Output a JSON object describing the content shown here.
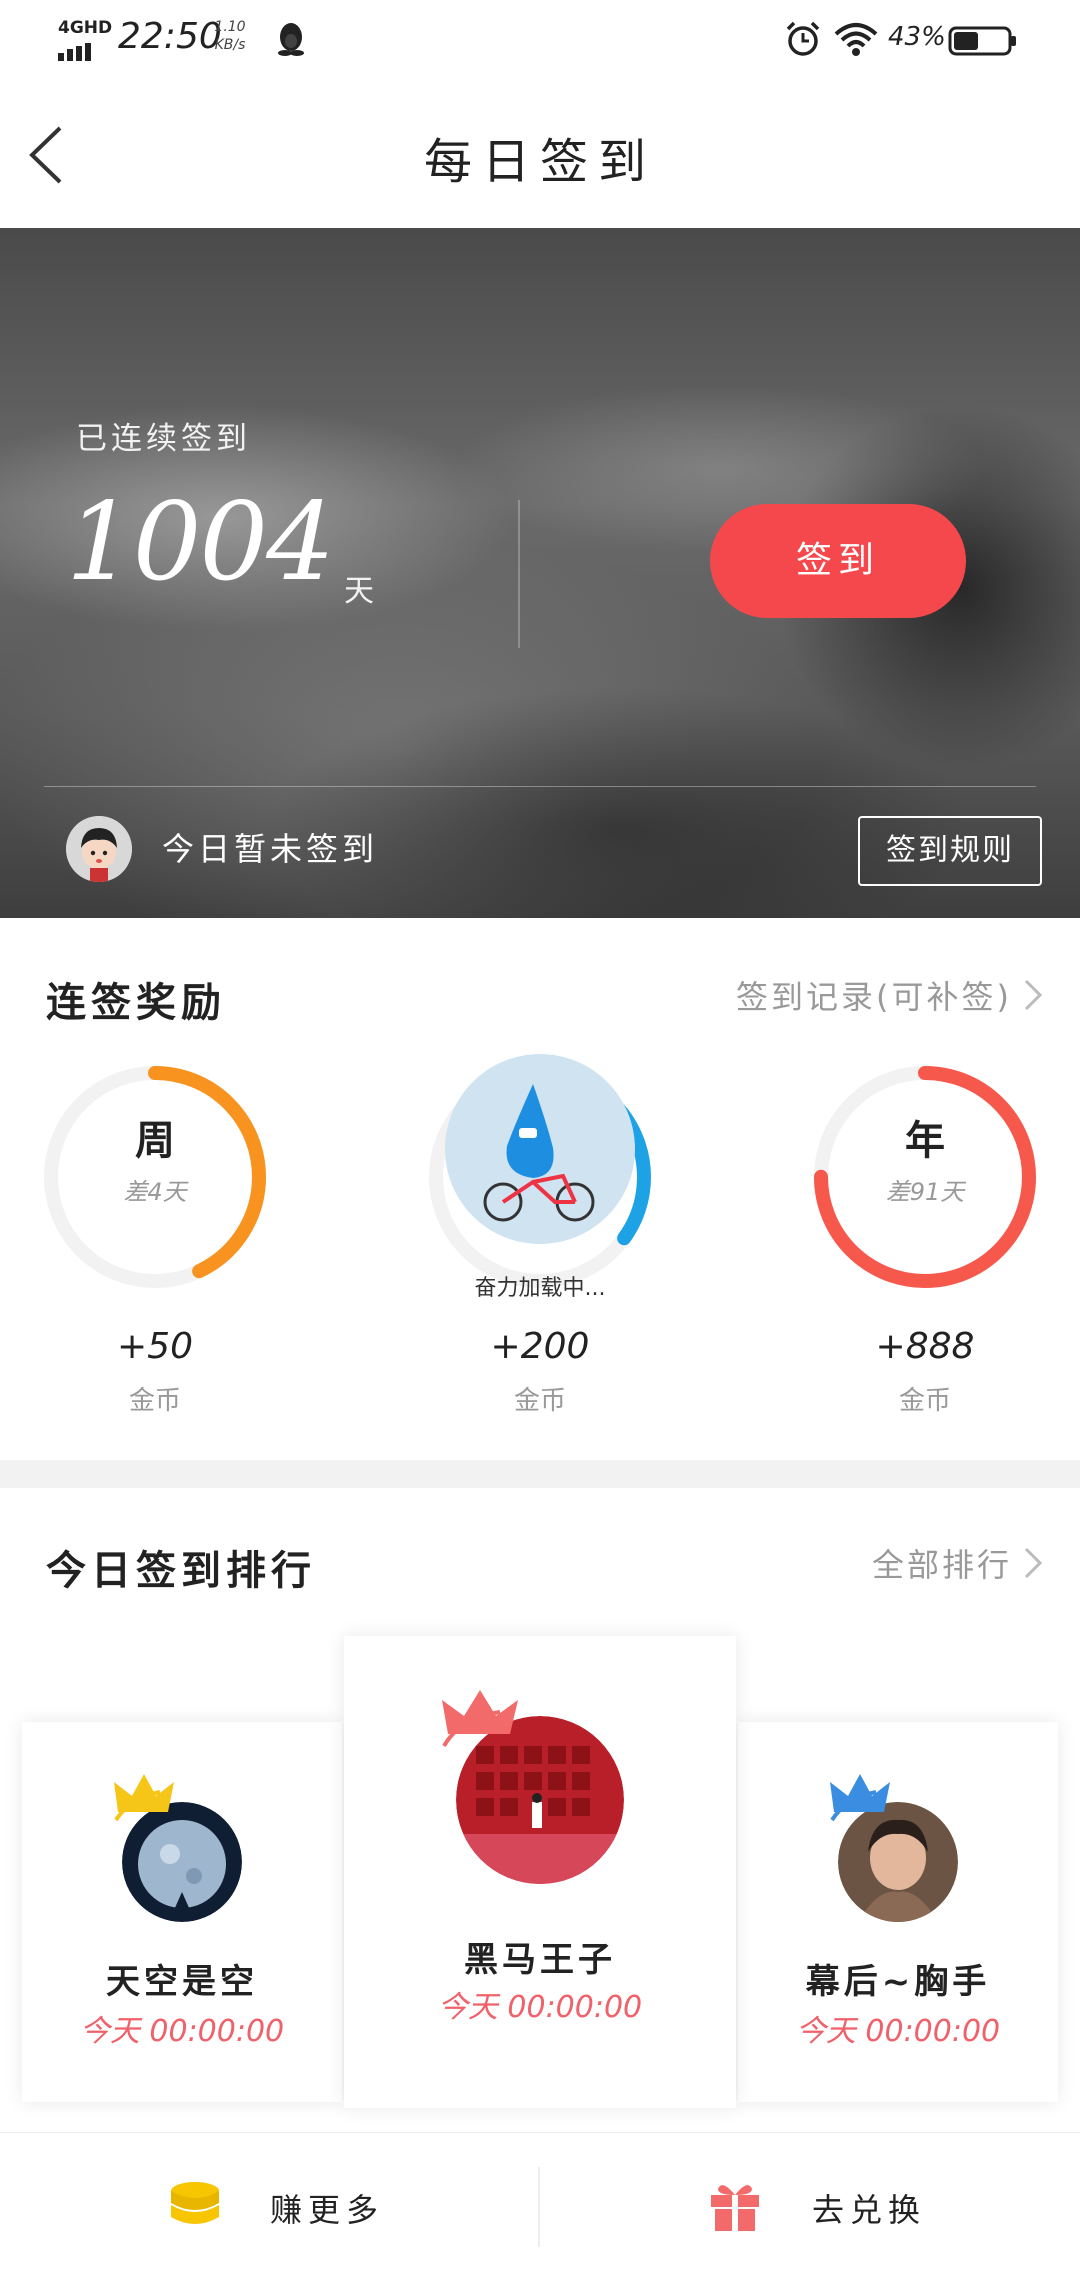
{
  "status_bar": {
    "network": "4GHD",
    "time": "22:50",
    "speed_value": "1.10",
    "speed_unit": "KB/s",
    "battery": "43%"
  },
  "header": {
    "title": "每日签到"
  },
  "hero": {
    "streak_label": "已连续签到",
    "streak_days": "1004",
    "streak_unit": "天",
    "checkin_button": "签到",
    "status_text": "今日暂未签到",
    "rules_button": "签到规则"
  },
  "rewards": {
    "title": "连签奖励",
    "record_link": "签到记录(可补签)",
    "items": [
      {
        "title": "周",
        "remaining": "差4天",
        "amount": "+50",
        "unit": "金币",
        "progress": 0.43,
        "color": "#f7931e"
      },
      {
        "loading_text": "奋力加载中...",
        "amount": "+200",
        "unit": "金币",
        "progress": 0.35,
        "color": "#1ea2e6"
      },
      {
        "title": "年",
        "remaining": "差91天",
        "amount": "+888",
        "unit": "金币",
        "progress": 0.75,
        "color": "#f7584c"
      }
    ]
  },
  "ranking": {
    "title": "今日签到排行",
    "all_link": "全部排行",
    "entries": [
      {
        "rank": 2,
        "name": "天空是空",
        "time": "今天  00:00:00",
        "crown_color": "#f5c518"
      },
      {
        "rank": 1,
        "name": "黑马王子",
        "time": "今天  00:00:00",
        "crown_color": "#f26a6a"
      },
      {
        "rank": 3,
        "name": "幕后~胸手",
        "time": "今天  00:00:00",
        "crown_color": "#3a8de0"
      }
    ]
  },
  "bottom_bar": {
    "earn_more": "赚更多",
    "redeem": "去兑换"
  }
}
